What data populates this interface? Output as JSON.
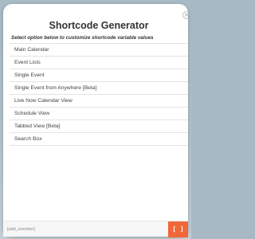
{
  "modal": {
    "title": "Shortcode Generator",
    "subtitle": "Select option below to customize shortcode variable values",
    "close_icon": "×",
    "options": [
      {
        "label": "Main Calendar"
      },
      {
        "label": "Event Lists"
      },
      {
        "label": "Single Event"
      },
      {
        "label": "Single Event from Anywhere [Beta]"
      },
      {
        "label": "Live Now Calendar View"
      },
      {
        "label": "Schedule View"
      },
      {
        "label": "Tabbed View [Beta]"
      },
      {
        "label": "Search Box"
      }
    ]
  },
  "footer": {
    "shortcode_value": "[add_eventon]",
    "insert_icon": "[ ]",
    "insert_icon_name": "shortcode-brackets-icon"
  },
  "colors": {
    "backdrop": "#a7b9c4",
    "modal_bg": "#ffffff",
    "accent": "#f0673a",
    "text": "#333333",
    "divider": "#e3e3e3"
  }
}
